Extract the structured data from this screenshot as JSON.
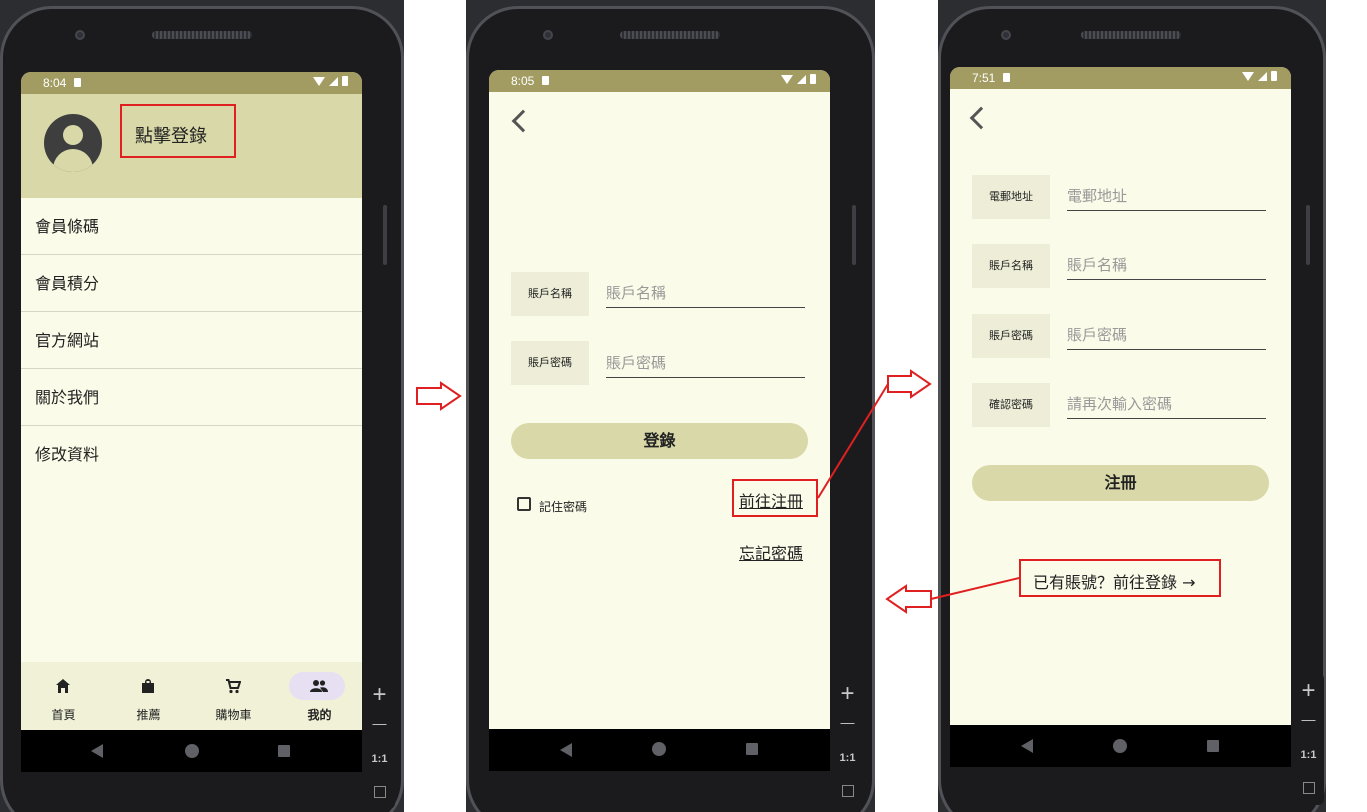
{
  "screens": [
    {
      "status": {
        "time": "8:04"
      },
      "profile": {
        "login_label": "點擊登錄"
      },
      "menu": [
        "會員條碼",
        "會員積分",
        "官方網站",
        "關於我們",
        "修改資料"
      ],
      "bottom_nav": [
        {
          "label": "首頁",
          "icon": "home-icon",
          "active": false
        },
        {
          "label": "推薦",
          "icon": "shopping-bag-icon",
          "active": false
        },
        {
          "label": "購物車",
          "icon": "cart-icon",
          "active": false
        },
        {
          "label": "我的",
          "icon": "people-icon",
          "active": true
        }
      ]
    },
    {
      "status": {
        "time": "8:05"
      },
      "fields": [
        {
          "label": "賬戶名稱",
          "placeholder": "賬戶名稱"
        },
        {
          "label": "賬戶密碼",
          "placeholder": "賬戶密碼"
        }
      ],
      "login_button": "登錄",
      "remember_label": "記住密碼",
      "register_link": "前往注冊",
      "forgot_link": "忘記密碼"
    },
    {
      "status": {
        "time": "7:51"
      },
      "fields": [
        {
          "label": "電郵地址",
          "placeholder": "電郵地址"
        },
        {
          "label": "賬戶名稱",
          "placeholder": "賬戶名稱"
        },
        {
          "label": "賬戶密碼",
          "placeholder": "賬戶密碼"
        },
        {
          "label": "確認密碼",
          "placeholder": "請再次輸入密碼"
        }
      ],
      "register_button": "注冊",
      "login_annotation": "已有賬號？前往登錄 →"
    }
  ],
  "zoom": {
    "plus": "+",
    "minus": "—",
    "ratio": "1:1"
  },
  "colors": {
    "status_bar": "#a29c62",
    "header": "#d8d8a8",
    "screen_bg": "#fbfbe9",
    "annotation": "#e02020"
  }
}
